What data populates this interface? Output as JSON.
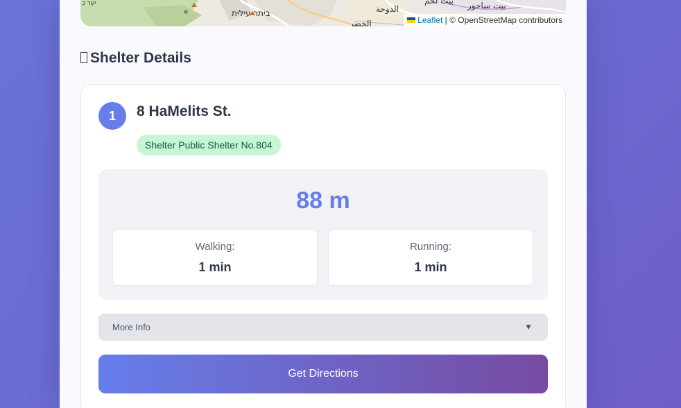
{
  "map": {
    "labels": [
      "ביתר עילית",
      "الدوحة",
      "بيت لحم",
      "بيت ساحور",
      "יער כ",
      "الخضر"
    ],
    "attribution_link": "Leaflet",
    "attribution_text": "| © OpenStreetMap contributors"
  },
  "section": {
    "icon": "shelter-icon",
    "title": "Shelter Details"
  },
  "shelter": {
    "index": "1",
    "address": "8 HaMelits St.",
    "type_badge": "Shelter Public Shelter No.804",
    "distance": "88 m",
    "walking_label": "Walking:",
    "walking_value": "1 min",
    "running_label": "Running:",
    "running_value": "1 min"
  },
  "more_info": {
    "label": "More Info",
    "chevron": "▼"
  },
  "directions_button": "Get Directions",
  "colors": {
    "accent": "#667eea",
    "gradient_end": "#764ba2",
    "badge_bg": "#c6f6d5",
    "badge_text": "#22543d"
  }
}
